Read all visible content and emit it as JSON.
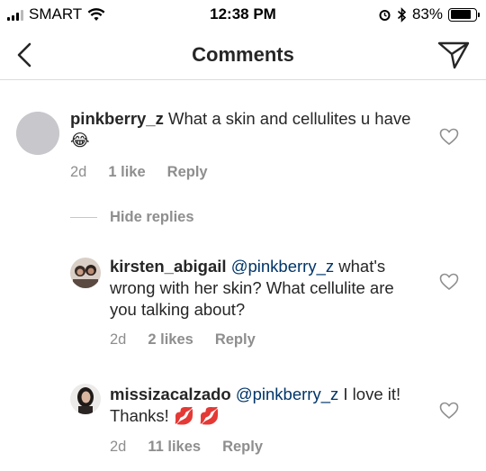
{
  "status_bar": {
    "carrier": "SMART",
    "time": "12:38 PM",
    "battery": "83%",
    "battery_level": 0.83,
    "icons": [
      "signal-icon",
      "wifi-icon",
      "alarm-icon",
      "bluetooth-icon",
      "battery-icon"
    ]
  },
  "nav": {
    "title": "Comments",
    "back_icon": "chevron-left-icon",
    "send_icon": "paper-plane-icon"
  },
  "comments": [
    {
      "username": "pinkberry_z",
      "text": "What a skin and cellulites u have",
      "emoji": "😂",
      "time": "2d",
      "likes": "1 like",
      "reply": "Reply"
    }
  ],
  "hide_replies": "Hide replies",
  "replies": [
    {
      "username": "kirsten_abigail",
      "mention": "@pinkberry_z",
      "text": "what's wrong with her skin? What cellulite are you talking about?",
      "time": "2d",
      "likes": "2 likes",
      "reply": "Reply"
    },
    {
      "username": "missizacalzado",
      "mention": "@pinkberry_z",
      "text": "I love it! Thanks!",
      "emoji": "💋 💋",
      "time": "2d",
      "likes": "11 likes",
      "reply": "Reply"
    }
  ],
  "colors": {
    "text": "#262626",
    "meta": "#8e8e8e",
    "mention": "#003569",
    "divider": "#dbdbdb"
  }
}
